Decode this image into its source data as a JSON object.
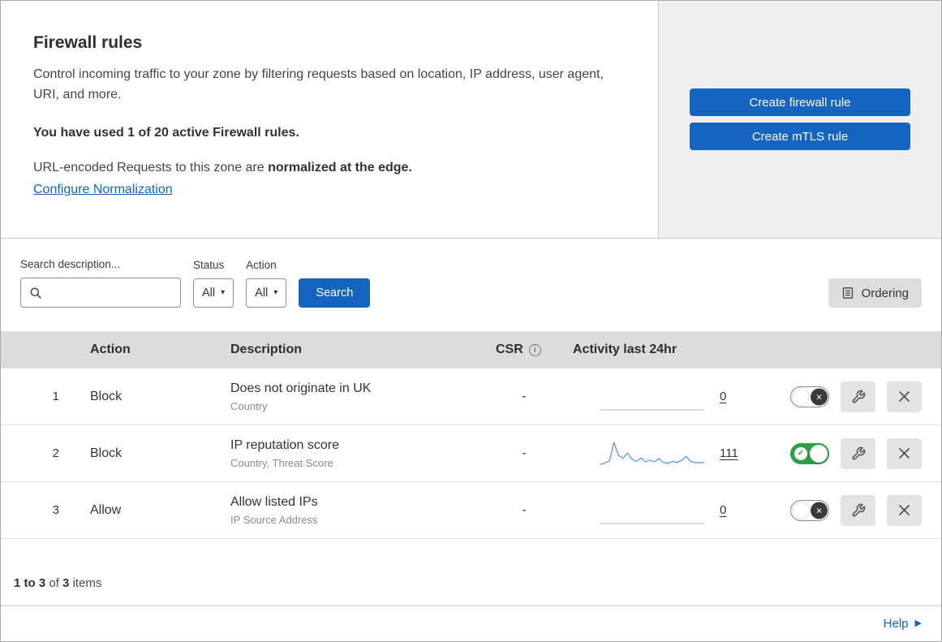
{
  "header": {
    "title": "Firewall rules",
    "description": "Control incoming traffic to your zone by filtering requests based on location, IP address, user agent, URI, and more.",
    "usage": "You have used 1 of 20 active Firewall rules.",
    "normalization_prefix": "URL-encoded Requests to this zone are ",
    "normalization_bold": "normalized at the edge.",
    "normalization_link": "Configure Normalization",
    "create_firewall_button": "Create firewall rule",
    "create_mtls_button": "Create mTLS rule"
  },
  "filters": {
    "search_label": "Search description...",
    "search_value": "",
    "status_label": "Status",
    "status_value": "All",
    "action_label": "Action",
    "action_value": "All",
    "search_button": "Search",
    "ordering_button": "Ordering"
  },
  "table": {
    "columns": {
      "action": "Action",
      "description": "Description",
      "csr": "CSR",
      "activity": "Activity last 24hr"
    },
    "rows": [
      {
        "index": "1",
        "action": "Block",
        "description": "Does not originate in UK",
        "criteria": "Country",
        "csr": "-",
        "activity_count": "0",
        "enabled": false
      },
      {
        "index": "2",
        "action": "Block",
        "description": "IP reputation score",
        "criteria": "Country, Threat Score",
        "csr": "-",
        "activity_count": "111",
        "enabled": true
      },
      {
        "index": "3",
        "action": "Allow",
        "description": "Allow listed IPs",
        "criteria": "IP Source Address",
        "csr": "-",
        "activity_count": "0",
        "enabled": false
      }
    ]
  },
  "chart_data": {
    "type": "line",
    "title": "Activity last 24hr",
    "x_range": "last 24 hours",
    "legend": "off",
    "color": "#6ba5e7",
    "series": [
      {
        "name": "Does not originate in UK",
        "values": [
          0,
          0,
          0
        ],
        "total": 0
      },
      {
        "name": "IP reputation score",
        "values": [
          6,
          10,
          15,
          64,
          30,
          22,
          36,
          19,
          14,
          23,
          13,
          17,
          13,
          21,
          11,
          9,
          14,
          11,
          17,
          27,
          13,
          11,
          10,
          12
        ],
        "total": 111
      },
      {
        "name": "Allow listed IPs",
        "values": [
          0,
          0,
          0
        ],
        "total": 0
      }
    ]
  },
  "footer": {
    "range": "1 to 3",
    "of": "of",
    "total": "3",
    "items": "items",
    "help": "Help"
  },
  "icons": {
    "caret_down": "▾",
    "info": "i",
    "help_arrow": "▶",
    "toggle_on_check": "✓",
    "toggle_off_x": "×"
  },
  "colors": {
    "primary_blue": "#1565c0",
    "link_blue": "#0f63c0",
    "toggle_green": "#2d9f46",
    "sparkline_blue": "#6ba5e7",
    "panel_gray": "#efefef",
    "table_header_gray": "#dcdcdc"
  }
}
